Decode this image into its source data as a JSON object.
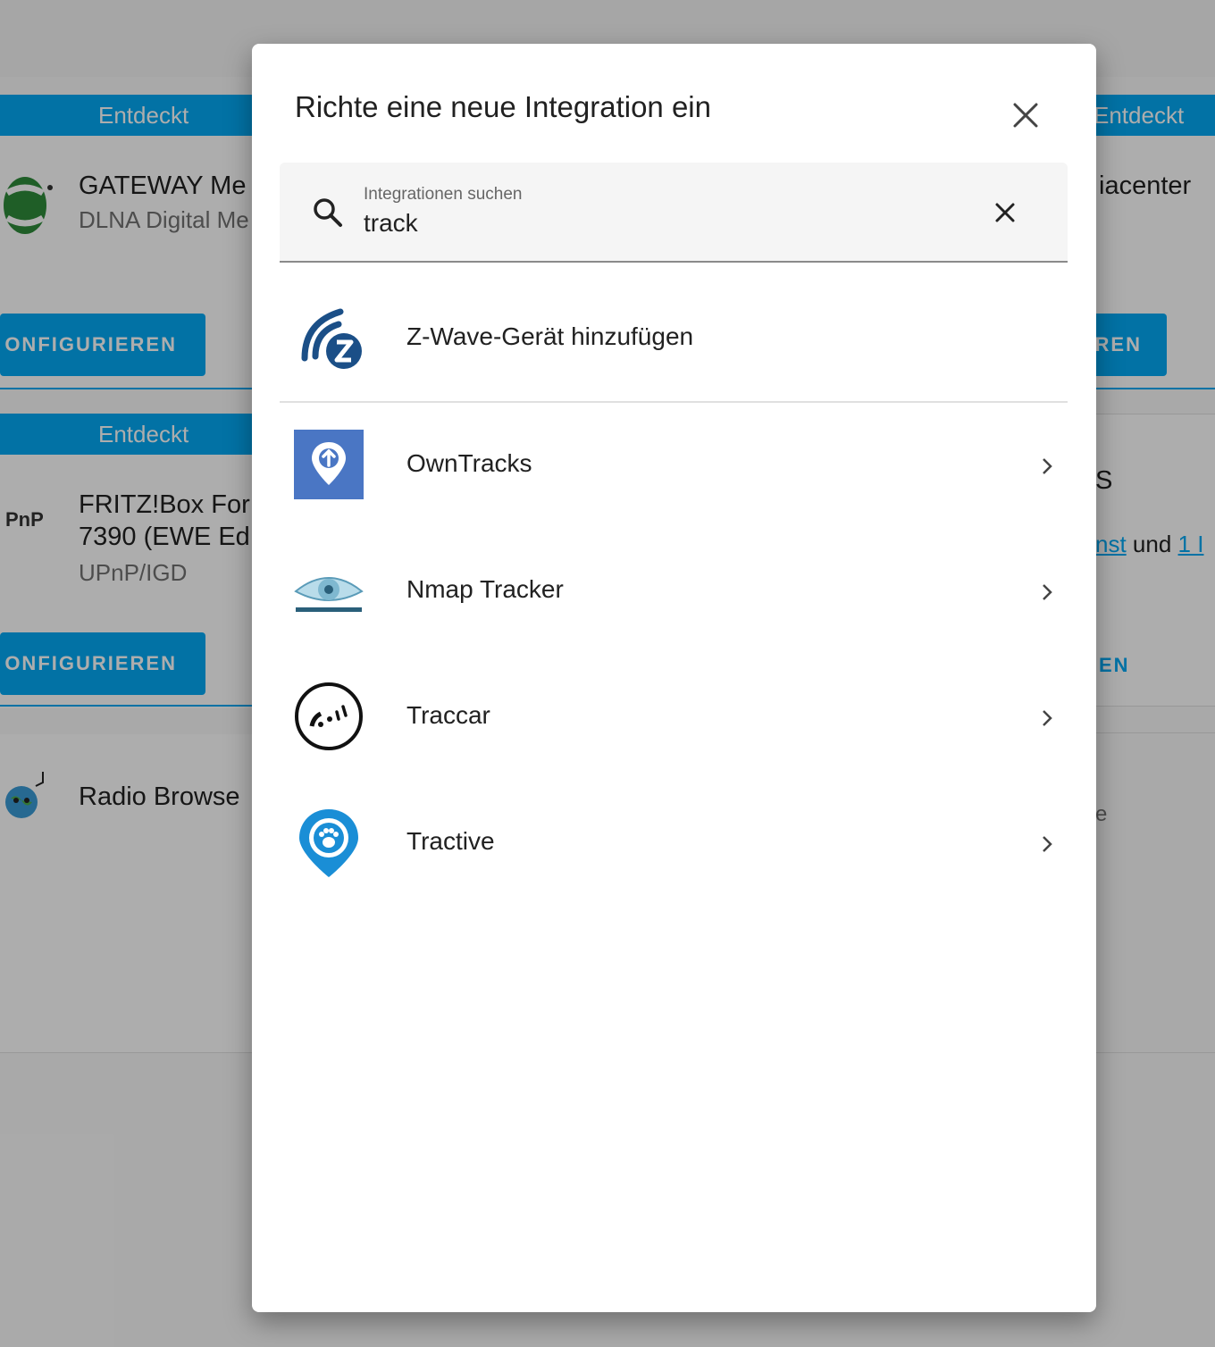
{
  "background": {
    "cards": [
      {
        "badge": "Entdeckt",
        "title": "GATEWAY Me",
        "subtitle": "DLNA Digital Me",
        "button": "ONFIGURIEREN"
      },
      {
        "badge": "Entdeckt",
        "title_line1": "FRITZ!Box For",
        "title_line2": "7390 (EWE Ed",
        "subtitle": "UPnP/IGD",
        "button": "ONFIGURIEREN"
      },
      {
        "title": "Radio Browse"
      }
    ],
    "right_cards": [
      {
        "badge": "Entdeckt",
        "title": "iacenter",
        "button": "REN"
      },
      {
        "title": "S",
        "text_link1": "nst",
        "text_und": "und",
        "text_link2": "1 I",
        "button": "EN"
      },
      {
        "text": "e"
      }
    ],
    "upnp_logo_text": "PnP"
  },
  "dialog": {
    "title": "Richte eine neue Integration ein",
    "search": {
      "label": "Integrationen suchen",
      "value": "track"
    },
    "items": [
      {
        "label": "Z-Wave-Gerät hinzufügen",
        "icon": "zwave-icon",
        "has_chevron": false
      },
      {
        "label": "OwnTracks",
        "icon": "owntracks-icon",
        "has_chevron": true
      },
      {
        "label": "Nmap Tracker",
        "icon": "nmap-icon",
        "has_chevron": true
      },
      {
        "label": "Traccar",
        "icon": "traccar-icon",
        "has_chevron": true
      },
      {
        "label": "Tractive",
        "icon": "tractive-icon",
        "has_chevron": true
      }
    ]
  },
  "colors": {
    "accent": "#03a9f4",
    "zwave": "#1b4f87",
    "owntracks": "#4a76c4",
    "tractive": "#1a8ed6"
  }
}
